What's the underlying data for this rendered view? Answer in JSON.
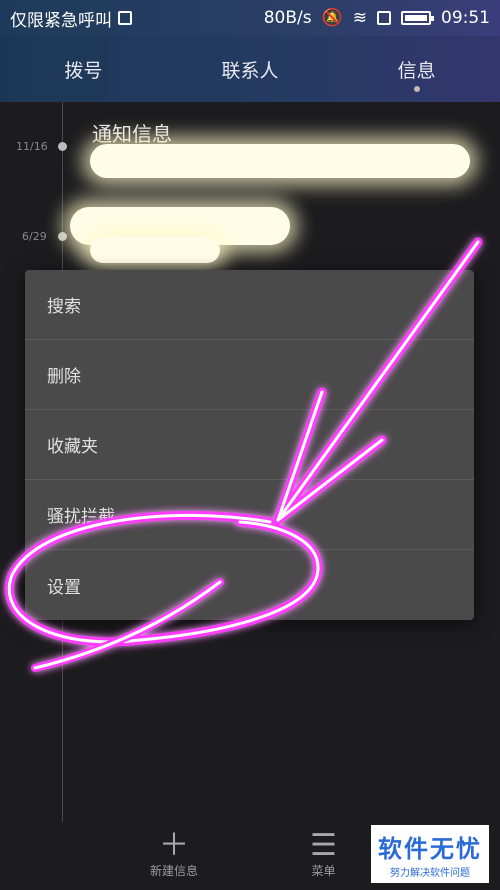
{
  "status": {
    "carrier": "仅限紧急呼叫",
    "speed": "80B/s",
    "time": "09:51"
  },
  "tabs": [
    {
      "label": "拨号"
    },
    {
      "label": "联系人"
    },
    {
      "label": "信息"
    }
  ],
  "conversations": {
    "notice_title": "通知信息",
    "dates": [
      "11/16",
      "6/29"
    ]
  },
  "menu": {
    "items": [
      {
        "label": "搜索"
      },
      {
        "label": "删除"
      },
      {
        "label": "收藏夹"
      },
      {
        "label": "骚扰拦截"
      },
      {
        "label": "设置"
      }
    ]
  },
  "bottom": {
    "new_message": "新建信息",
    "menu": "菜单"
  },
  "watermark": {
    "title": "软件无忧",
    "subtitle": "努力解决软件问题"
  }
}
